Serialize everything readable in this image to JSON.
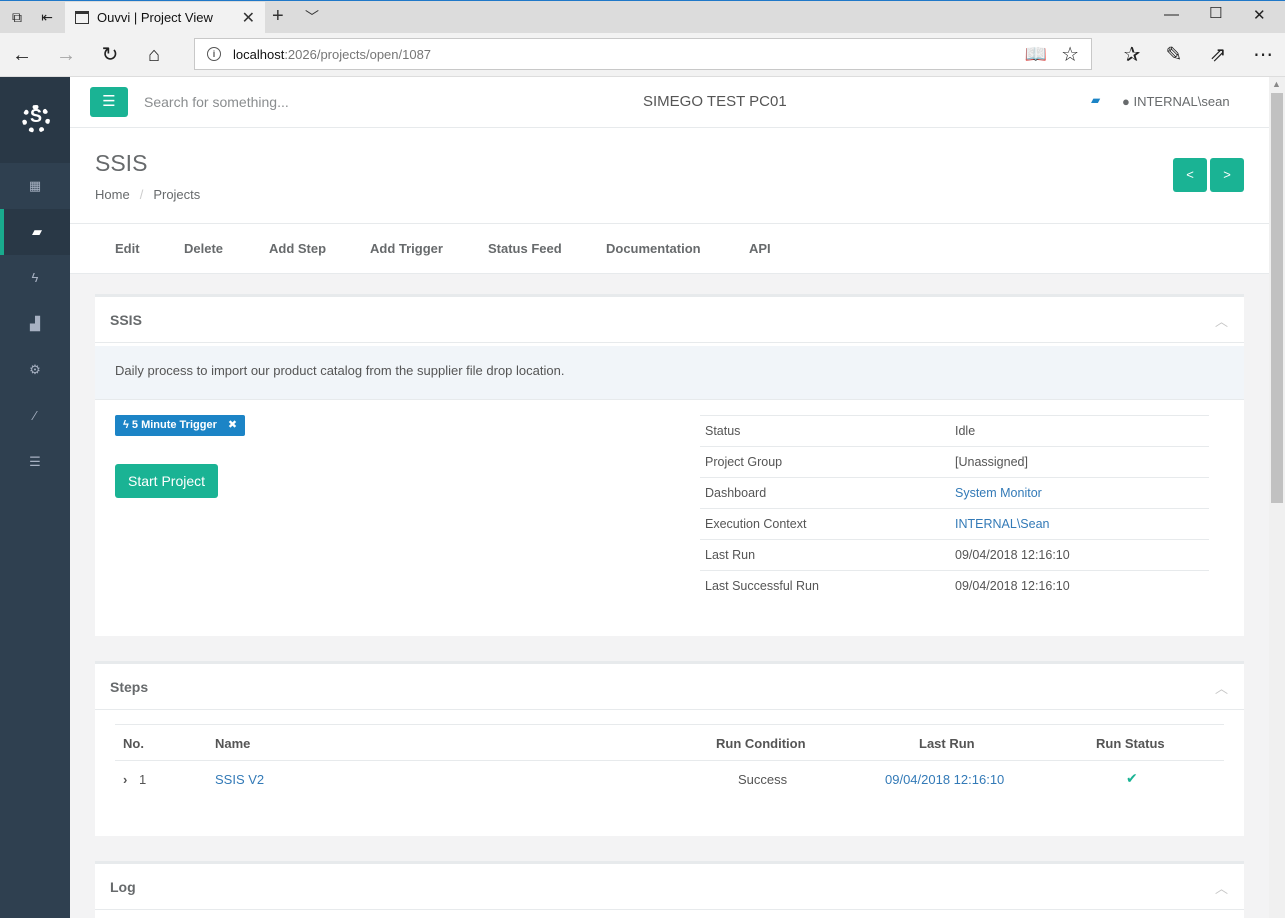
{
  "browser": {
    "tab_title": "Ouvvi | Project View",
    "new_tab_symbol": "+",
    "url_host": "localhost",
    "url_rest": ":2026/projects/open/1087"
  },
  "header": {
    "search_placeholder": "Search for something...",
    "hostname": "SIMEGO TEST PC01",
    "user": "INTERNAL\\sean"
  },
  "page": {
    "title": "SSIS",
    "breadcrumb": [
      "Home",
      "Projects"
    ],
    "prev_label": "<",
    "next_label": ">"
  },
  "menu": [
    "Edit",
    "Delete",
    "Add Step",
    "Add Trigger",
    "Status Feed",
    "Documentation",
    "API"
  ],
  "project": {
    "panel_title": "SSIS",
    "description": "Daily process to import our product catalog from the supplier file drop location.",
    "trigger_label": "5 Minute Trigger",
    "start_button": "Start Project",
    "properties": [
      {
        "key": "Status",
        "value": "Idle"
      },
      {
        "key": "Project Group",
        "value": "[Unassigned]"
      },
      {
        "key": "Dashboard",
        "value": "System Monitor"
      },
      {
        "key": "Execution Context",
        "value": "INTERNAL\\Sean"
      },
      {
        "key": "Last Run",
        "value": "09/04/2018 12:16:10"
      },
      {
        "key": "Last Successful Run",
        "value": "09/04/2018 12:16:10"
      }
    ]
  },
  "steps": {
    "panel_title": "Steps",
    "columns": [
      "No.",
      "Name",
      "Run Condition",
      "Last Run",
      "Run Status"
    ],
    "rows": [
      {
        "no": "1",
        "name": "SSIS V2",
        "run_condition": "Success",
        "last_run": "09/04/2018 12:16:10",
        "run_status_icon": "check-icon"
      }
    ]
  },
  "log": {
    "panel_title": "Log"
  },
  "colors": {
    "accent": "#1ab394",
    "sidebar": "#2f4050",
    "link": "#337ab7",
    "badge": "#1c84c6"
  }
}
